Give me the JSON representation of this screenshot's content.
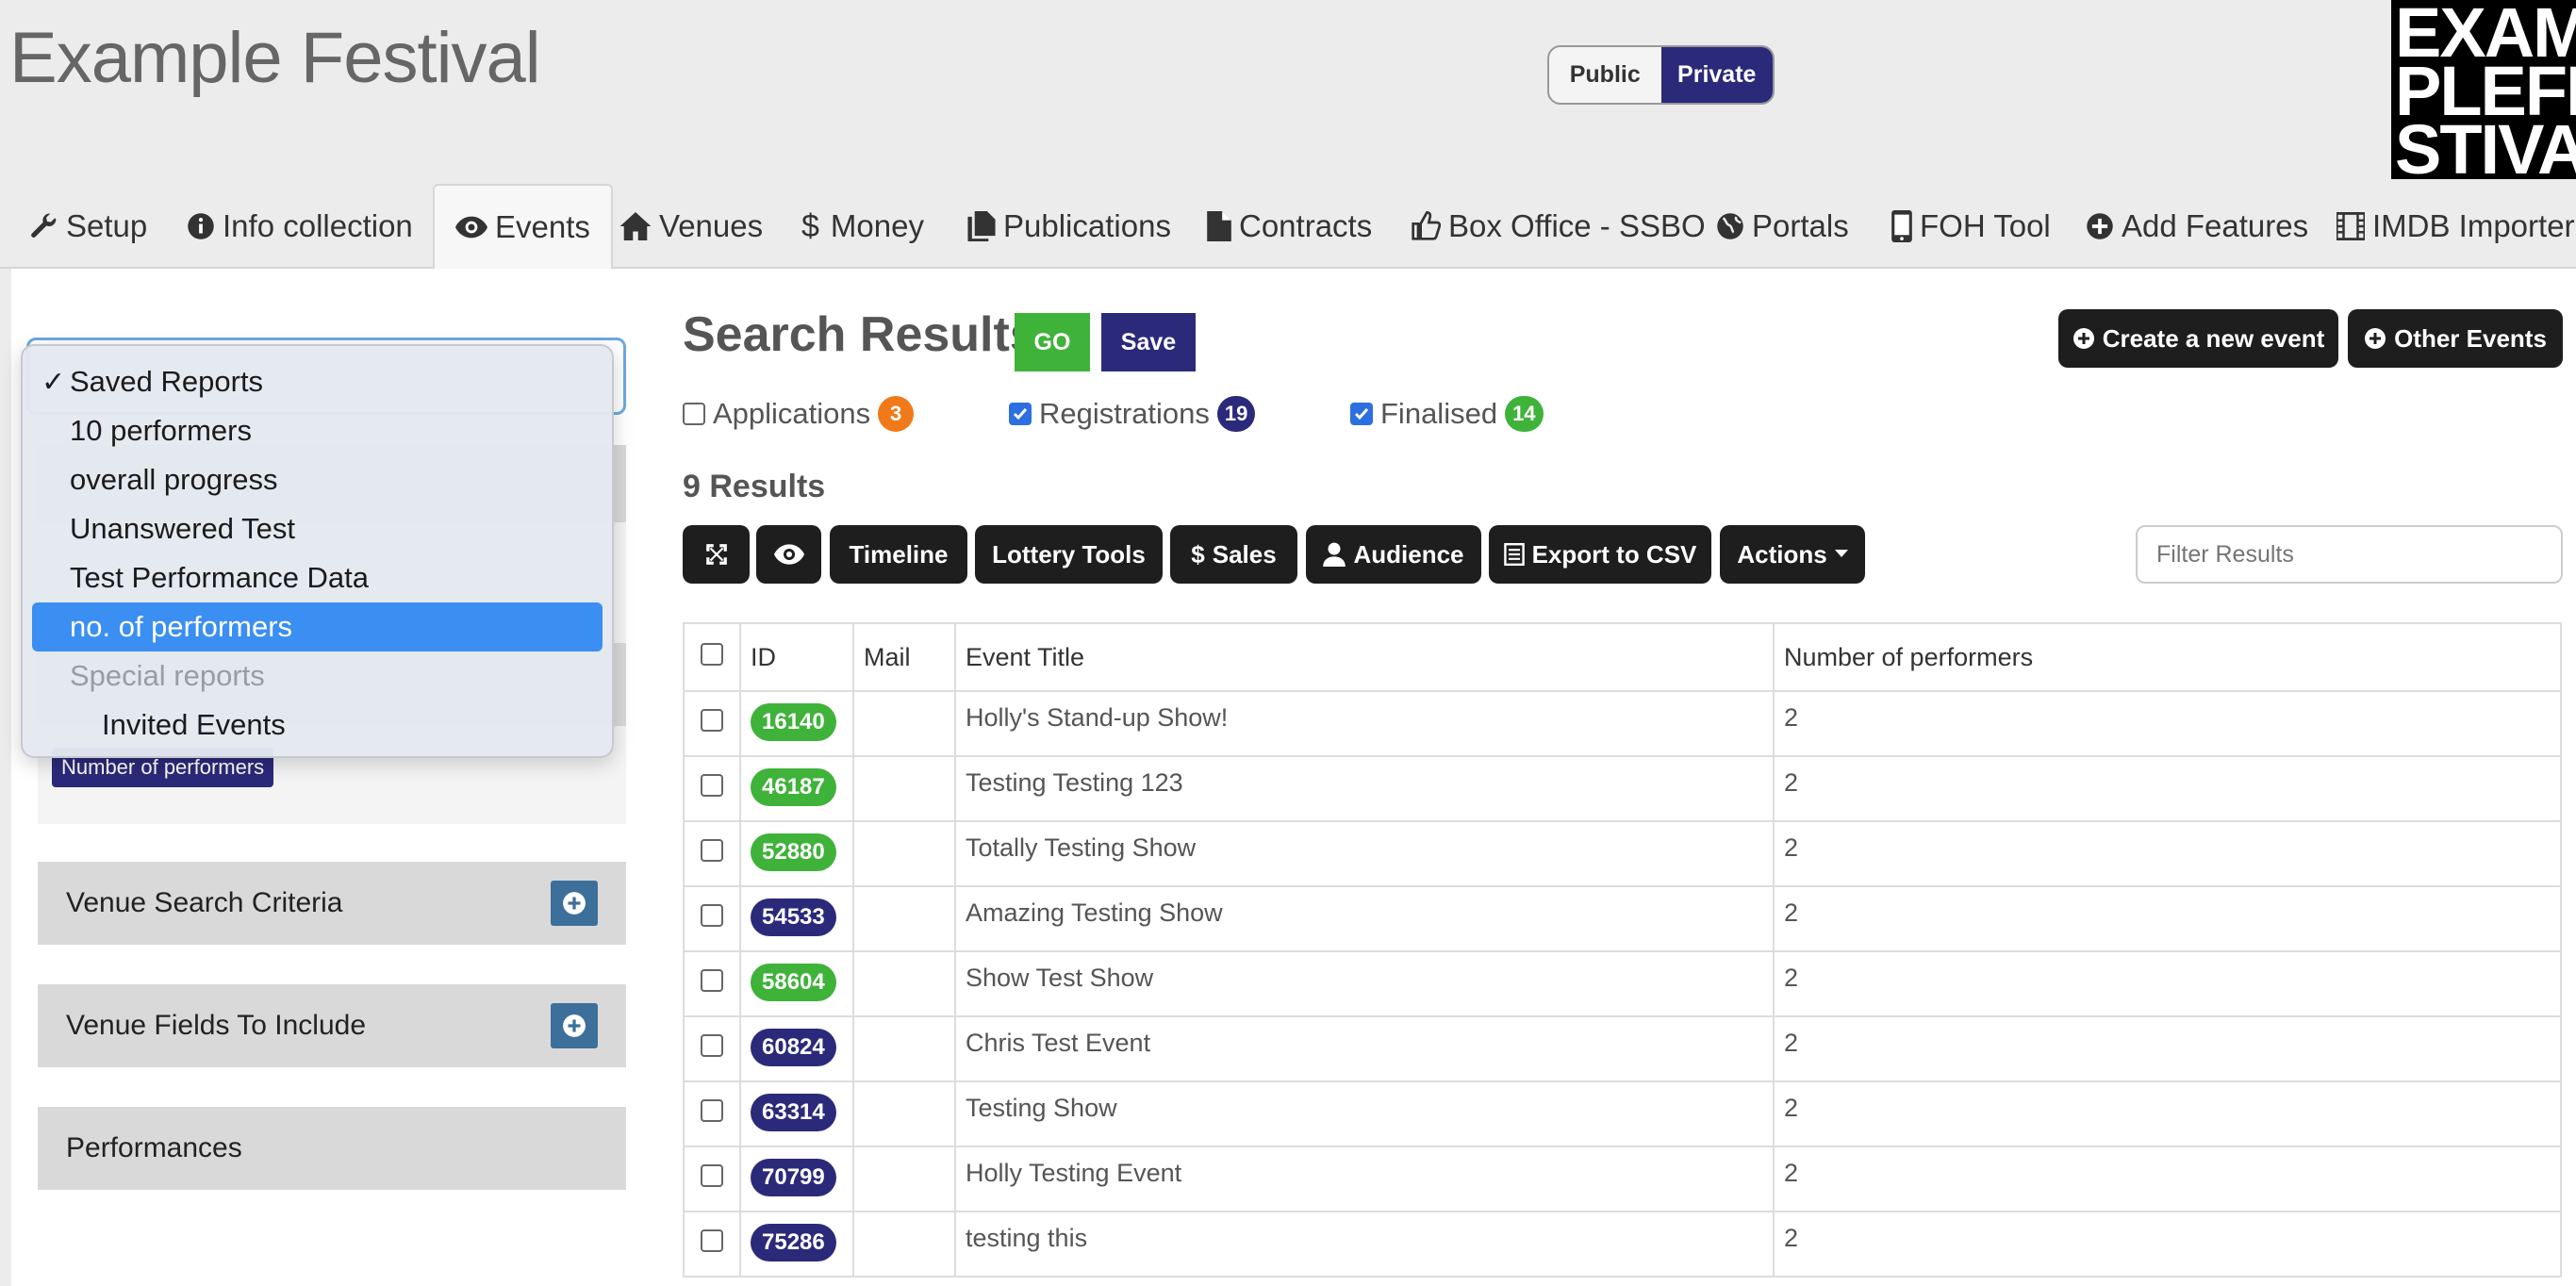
{
  "app": {
    "title": "Example Festival",
    "logo_text": "EXAMPLE FESTIVAL",
    "logo_lines": [
      "EXAM",
      "PLEFE",
      "STIVAL"
    ]
  },
  "visibility_toggle": {
    "options": [
      "Public",
      "Private"
    ],
    "selected": "Private"
  },
  "nav": {
    "items": [
      {
        "label": "Setup",
        "icon": "wrench-icon"
      },
      {
        "label": "Info collection",
        "icon": "info-icon"
      },
      {
        "label": "Events",
        "icon": "eye-icon",
        "active": true
      },
      {
        "label": "Venues",
        "icon": "home-icon"
      },
      {
        "label": "Money",
        "icon": "dollar-icon"
      },
      {
        "label": "Publications",
        "icon": "files-icon"
      },
      {
        "label": "Contracts",
        "icon": "file-icon"
      },
      {
        "label": "Box Office - SSBO",
        "icon": "thumbs-up-icon"
      },
      {
        "label": "Portals",
        "icon": "globe-icon"
      },
      {
        "label": "FOH Tool",
        "icon": "phone-icon"
      },
      {
        "label": "Add Features",
        "icon": "plus-circle-icon"
      },
      {
        "label": "IMDB Importer",
        "icon": "film-icon"
      }
    ]
  },
  "sidebar": {
    "saved_reports_dropdown": {
      "options": [
        {
          "label": "Saved Reports",
          "checked": true
        },
        {
          "label": "10 performers"
        },
        {
          "label": "overall progress"
        },
        {
          "label": "Unanswered Test"
        },
        {
          "label": "Test Performance Data"
        },
        {
          "label": "no. of performers",
          "highlighted": true
        },
        {
          "label": "Special reports",
          "group": true
        },
        {
          "label": "Invited Events",
          "indent": true
        }
      ]
    },
    "field_tag": "Number of performers",
    "sections": [
      "Venue Search Criteria",
      "Venue Fields To Include",
      "Performances"
    ]
  },
  "results": {
    "title": "Search Results",
    "go_label": "GO",
    "save_label": "Save",
    "create_event_label": "Create a new event",
    "other_events_label": "Other Events",
    "filters": [
      {
        "label": "Applications",
        "count": "3",
        "checked": false,
        "color": "#f07a1a"
      },
      {
        "label": "Registrations",
        "count": "19",
        "checked": true,
        "color": "#2b2a7a"
      },
      {
        "label": "Finalised",
        "count": "14",
        "checked": true,
        "color": "#3fb23a"
      }
    ],
    "count_label": "9 Results",
    "toolbar": {
      "expand_icon": "expand-icon",
      "preview_icon": "eye-icon",
      "timeline": "Timeline",
      "lottery_tools": "Lottery Tools",
      "sales": "Sales",
      "audience": "Audience",
      "export_csv": "Export to CSV",
      "actions": "Actions"
    },
    "filter_placeholder": "Filter Results",
    "table": {
      "columns": [
        "ID",
        "Mail",
        "Event Title",
        "Number of performers"
      ],
      "rows": [
        {
          "id": "16140",
          "status": "green",
          "title": "Holly's Stand-up Show!",
          "performers": "2"
        },
        {
          "id": "46187",
          "status": "green",
          "title": "Testing Testing 123",
          "performers": "2"
        },
        {
          "id": "52880",
          "status": "green",
          "title": "Totally Testing Show",
          "performers": "2"
        },
        {
          "id": "54533",
          "status": "navy",
          "title": "Amazing Testing Show",
          "performers": "2"
        },
        {
          "id": "58604",
          "status": "green",
          "title": "Show Test Show",
          "performers": "2"
        },
        {
          "id": "60824",
          "status": "navy",
          "title": "Chris Test Event",
          "performers": "2"
        },
        {
          "id": "63314",
          "status": "navy",
          "title": "Testing Show",
          "performers": "2"
        },
        {
          "id": "70799",
          "status": "navy",
          "title": "Holly Testing Event",
          "performers": "2"
        },
        {
          "id": "75286",
          "status": "navy",
          "title": "testing this",
          "performers": "2"
        }
      ]
    }
  },
  "colors": {
    "green": "#3fb23a",
    "navy": "#2b2a7a",
    "orange": "#f07a1a",
    "dropdown_highlight": "#3b8ff2"
  }
}
